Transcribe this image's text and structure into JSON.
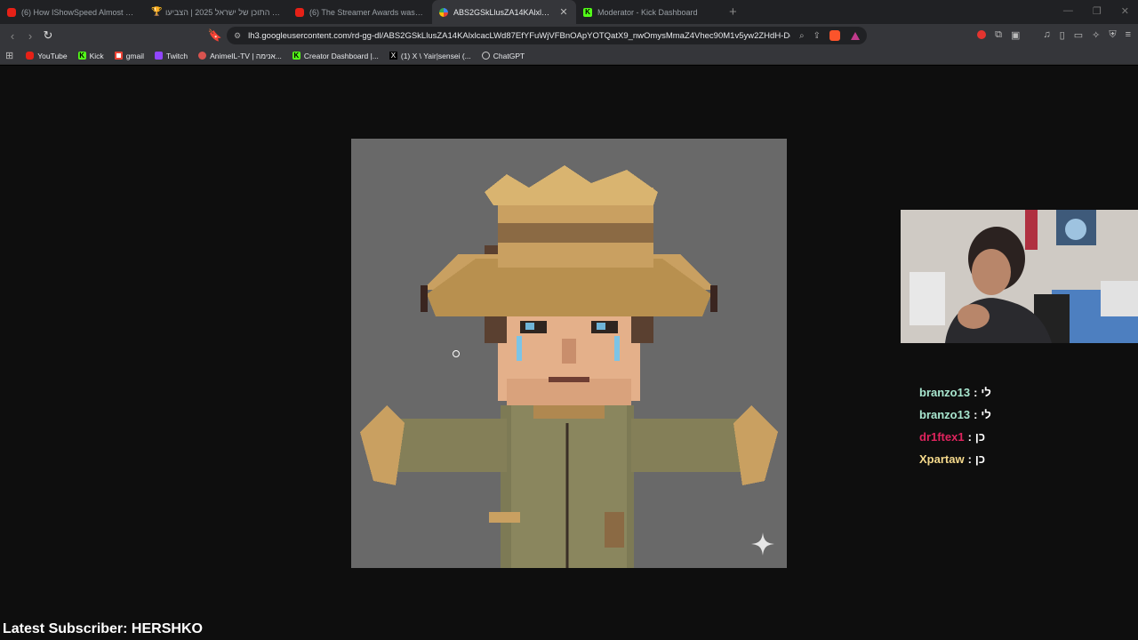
{
  "browser": {
    "tabs": [
      {
        "title": "(6) How IShowSpeed Almost Ruined",
        "icon": "youtube-icon",
        "active": false
      },
      {
        "title": "פרטי התוכן של ישראל 2025 | הצביעו",
        "icon": "trophy-icon",
        "active": false
      },
      {
        "title": "(6) The Streamer Awards was a Disas",
        "icon": "youtube-icon",
        "active": false
      },
      {
        "title": "ABS2GSkLlusZA14KAlxlcacLWd8",
        "icon": "image-icon",
        "active": true
      },
      {
        "title": "Moderator - Kick Dashboard",
        "icon": "kick-icon",
        "active": false
      }
    ],
    "url": "lh3.googleusercontent.com/rd-gg-dl/ABS2GSkLlusZA14KAlxlcacLWd87EfYFuWjVFBnOApYOTQatX9_nwOmysMmaZ4Vhec90M1v5yw2ZHdH-De...",
    "bookmarks": [
      {
        "label": "YouTube",
        "icon": "youtube-icon"
      },
      {
        "label": "Kick",
        "icon": "kick-icon"
      },
      {
        "label": "gmail",
        "icon": "gmail-icon"
      },
      {
        "label": "Twitch",
        "icon": "twitch-icon"
      },
      {
        "label": "AnimeIL-TV | אנימה...",
        "icon": "anime-icon"
      },
      {
        "label": "Creator Dashboard |...",
        "icon": "kick-icon"
      },
      {
        "label": "(1) X \\ Yair|sensei (...",
        "icon": "x-icon"
      },
      {
        "label": "ChatGPT",
        "icon": "chatgpt-icon"
      }
    ]
  },
  "chat": {
    "messages": [
      {
        "user": "branzo13",
        "text": "לי",
        "color": "#a8e6cf"
      },
      {
        "user": "branzo13",
        "text": "לי",
        "color": "#a8e6cf"
      },
      {
        "user": "dr1ftex1",
        "text": "כן",
        "color": "#e0245e"
      },
      {
        "user": "Xpartaw",
        "text": "כן",
        "color": "#f5d98b"
      }
    ]
  },
  "stream": {
    "latest_subscriber": "Latest Subscriber: HERSHKO"
  },
  "colors": {
    "chrome_dark": "#202124",
    "chrome_mid": "#35363a",
    "artwork_bg": "#696969"
  }
}
